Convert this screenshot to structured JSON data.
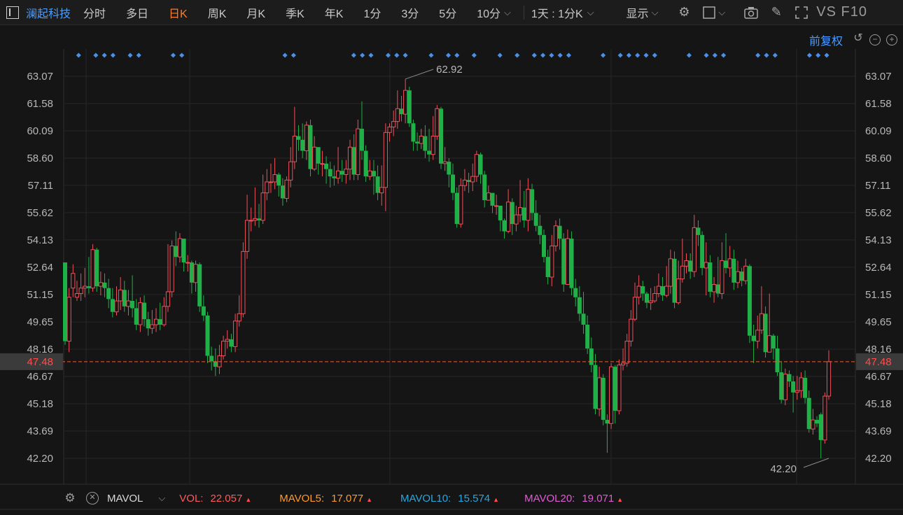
{
  "toolbar": {
    "stock_name": "澜起科技",
    "tabs": [
      "分时",
      "多日",
      "日K",
      "周K",
      "月K",
      "季K",
      "年K",
      "1分",
      "3分",
      "5分",
      "10分"
    ],
    "active_tab": "日K",
    "period": "1天 : 1分K",
    "display": "显示",
    "f10": "VS F10"
  },
  "subbar": {
    "adjust": "前复权"
  },
  "colors": {
    "up": "#f0505a",
    "down": "#1fb148",
    "bg": "#151515",
    "accent": "#4a9cff",
    "current": "#e8613a"
  },
  "chart_data": {
    "type": "candlestick",
    "y_ticks": [
      "63.07",
      "61.58",
      "60.09",
      "58.60",
      "57.11",
      "55.62",
      "54.13",
      "52.64",
      "51.15",
      "49.65",
      "48.16",
      "46.67",
      "45.18",
      "43.69",
      "42.20"
    ],
    "ylim": [
      42.2,
      63.07
    ],
    "current_price": "47.48",
    "max_label": "62.92",
    "min_label": "42.20",
    "candles": [
      [
        52.9,
        48.6,
        52.9,
        48.4
      ],
      [
        48.6,
        51.0,
        51.5,
        48.0
      ],
      [
        51.5,
        52.3,
        52.8,
        51.0
      ],
      [
        51.0,
        51.2,
        51.9,
        50.8
      ],
      [
        51.2,
        51.5,
        52.3,
        50.8
      ],
      [
        51.5,
        51.6,
        52.6,
        51.0
      ],
      [
        51.6,
        51.5,
        53.2,
        51.2
      ],
      [
        51.5,
        53.6,
        53.9,
        51.3
      ],
      [
        53.6,
        51.6,
        53.7,
        51.3
      ],
      [
        51.6,
        51.8,
        52.4,
        51.1
      ],
      [
        51.8,
        51.5,
        52.3,
        51.0
      ],
      [
        51.5,
        50.9,
        52.0,
        50.4
      ],
      [
        50.9,
        50.2,
        51.5,
        49.9
      ],
      [
        50.2,
        50.8,
        51.6,
        50.0
      ],
      [
        50.8,
        51.4,
        52.1,
        50.3
      ],
      [
        51.4,
        50.5,
        51.9,
        50.2
      ],
      [
        50.5,
        50.8,
        51.4,
        50.0
      ],
      [
        50.8,
        50.4,
        52.2,
        49.9
      ],
      [
        50.4,
        49.5,
        50.9,
        49.2
      ],
      [
        49.5,
        50.7,
        51.0,
        49.1
      ],
      [
        50.7,
        49.8,
        51.1,
        49.4
      ],
      [
        49.8,
        49.3,
        50.2,
        48.9
      ],
      [
        49.3,
        49.5,
        50.3,
        49.0
      ],
      [
        49.5,
        49.8,
        50.4,
        49.1
      ],
      [
        49.8,
        49.5,
        50.7,
        49.2
      ],
      [
        49.5,
        50.5,
        51.0,
        49.4
      ],
      [
        50.5,
        51.3,
        53.9,
        50.2
      ],
      [
        51.3,
        53.8,
        54.1,
        51.0
      ],
      [
        53.8,
        53.2,
        54.6,
        52.7
      ],
      [
        53.2,
        54.2,
        54.5,
        52.9
      ],
      [
        54.2,
        52.9,
        53.6,
        52.4
      ],
      [
        52.9,
        52.9,
        53.3,
        52.4
      ],
      [
        52.9,
        51.8,
        53.0,
        51.2
      ],
      [
        51.8,
        52.8,
        53.0,
        51.3
      ],
      [
        52.8,
        50.5,
        52.9,
        50.2
      ],
      [
        50.5,
        50.0,
        51.1,
        49.7
      ],
      [
        50.0,
        47.8,
        50.2,
        47.4
      ],
      [
        47.8,
        47.5,
        48.3,
        47.0
      ],
      [
        47.5,
        47.2,
        48.2,
        46.7
      ],
      [
        47.2,
        47.8,
        48.4,
        46.8
      ],
      [
        47.8,
        48.6,
        48.9,
        47.6
      ],
      [
        48.6,
        48.7,
        49.2,
        48.2
      ],
      [
        48.7,
        48.3,
        49.0,
        48.0
      ],
      [
        48.3,
        49.7,
        50.1,
        48.0
      ],
      [
        49.7,
        50.1,
        51.1,
        49.4
      ],
      [
        50.1,
        53.5,
        54.0,
        49.9
      ],
      [
        53.5,
        55.2,
        56.6,
        53.1
      ],
      [
        55.2,
        55.2,
        55.9,
        54.6
      ],
      [
        55.2,
        55.3,
        57.0,
        54.9
      ],
      [
        55.3,
        55.2,
        56.1,
        54.8
      ],
      [
        55.2,
        56.7,
        57.7,
        55.0
      ],
      [
        56.7,
        57.3,
        58.0,
        56.3
      ],
      [
        57.3,
        57.3,
        58.3,
        56.7
      ],
      [
        57.3,
        57.7,
        58.6,
        56.9
      ],
      [
        57.7,
        57.1,
        57.8,
        56.5
      ],
      [
        57.1,
        56.4,
        57.5,
        56.0
      ],
      [
        56.4,
        57.4,
        57.6,
        56.2
      ],
      [
        57.4,
        58.4,
        59.2,
        57.0
      ],
      [
        58.4,
        59.8,
        61.4,
        58.0
      ],
      [
        59.8,
        59.6,
        60.4,
        59.0
      ],
      [
        59.6,
        59.0,
        60.5,
        58.6
      ],
      [
        59.0,
        60.4,
        60.6,
        58.5
      ],
      [
        60.4,
        58.0,
        60.7,
        57.6
      ],
      [
        58.0,
        59.2,
        59.8,
        57.9
      ],
      [
        59.2,
        58.3,
        58.6,
        57.7
      ],
      [
        58.3,
        58.3,
        59.0,
        57.6
      ],
      [
        58.3,
        58.0,
        58.7,
        57.2
      ],
      [
        58.0,
        57.6,
        58.4,
        57.0
      ],
      [
        57.6,
        57.5,
        58.2,
        57.1
      ],
      [
        57.5,
        57.9,
        59.2,
        57.2
      ],
      [
        57.9,
        57.7,
        58.5,
        57.3
      ],
      [
        57.7,
        58.0,
        58.5,
        57.2
      ],
      [
        58.0,
        59.2,
        59.6,
        57.4
      ],
      [
        59.2,
        57.7,
        59.9,
        57.4
      ],
      [
        57.7,
        60.2,
        60.7,
        57.4
      ],
      [
        60.2,
        59.0,
        61.7,
        58.5
      ],
      [
        59.0,
        57.6,
        59.3,
        57.3
      ],
      [
        57.6,
        57.9,
        58.5,
        57.4
      ],
      [
        57.9,
        57.6,
        58.5,
        56.6
      ],
      [
        57.6,
        56.7,
        58.2,
        56.3
      ],
      [
        56.7,
        57.0,
        58.2,
        56.0
      ],
      [
        57.0,
        60.0,
        60.5,
        55.7
      ],
      [
        60.0,
        60.3,
        60.5,
        59.5
      ],
      [
        60.3,
        60.6,
        61.2,
        59.8
      ],
      [
        60.6,
        61.3,
        62.3,
        60.2
      ],
      [
        61.3,
        61.0,
        62.0,
        60.6
      ],
      [
        61.0,
        62.3,
        62.92,
        60.5
      ],
      [
        62.3,
        60.5,
        62.5,
        60.3
      ],
      [
        60.5,
        59.5,
        60.7,
        59.0
      ],
      [
        59.5,
        59.4,
        60.0,
        59.0
      ],
      [
        59.4,
        59.8,
        60.2,
        59.1
      ],
      [
        59.8,
        59.0,
        60.4,
        58.6
      ],
      [
        59.0,
        58.8,
        60.2,
        58.4
      ],
      [
        58.8,
        59.8,
        60.9,
        58.5
      ],
      [
        59.8,
        61.3,
        61.5,
        59.6
      ],
      [
        61.3,
        58.3,
        61.4,
        58.0
      ],
      [
        58.3,
        58.4,
        59.2,
        57.9
      ],
      [
        58.4,
        57.7,
        58.6,
        57.0
      ],
      [
        57.7,
        56.7,
        58.3,
        56.3
      ],
      [
        56.7,
        55.0,
        57.0,
        54.8
      ],
      [
        55.0,
        57.1,
        57.5,
        54.8
      ],
      [
        57.1,
        57.4,
        58.0,
        56.8
      ],
      [
        57.4,
        57.3,
        57.8,
        56.7
      ],
      [
        57.3,
        57.6,
        58.3,
        56.8
      ],
      [
        57.6,
        58.8,
        59.0,
        57.3
      ],
      [
        58.8,
        57.7,
        58.9,
        57.2
      ],
      [
        57.7,
        56.3,
        57.9,
        55.9
      ],
      [
        56.3,
        56.7,
        57.1,
        56.3
      ],
      [
        56.7,
        56.0,
        56.6,
        55.6
      ],
      [
        56.0,
        56.0,
        56.6,
        55.5
      ],
      [
        56.0,
        55.2,
        55.8,
        54.6
      ],
      [
        55.2,
        54.6,
        55.3,
        54.2
      ],
      [
        54.6,
        56.2,
        56.9,
        54.5
      ],
      [
        56.2,
        55.0,
        56.4,
        54.4
      ],
      [
        55.0,
        55.5,
        56.0,
        54.6
      ],
      [
        55.5,
        55.9,
        57.4,
        55.1
      ],
      [
        55.9,
        55.2,
        56.8,
        54.8
      ],
      [
        55.2,
        56.9,
        57.5,
        54.6
      ],
      [
        56.9,
        55.6,
        57.2,
        55.2
      ],
      [
        55.6,
        54.9,
        56.3,
        54.6
      ],
      [
        54.9,
        54.4,
        55.5,
        53.9
      ],
      [
        54.4,
        53.2,
        54.7,
        52.9
      ],
      [
        53.2,
        52.1,
        53.6,
        51.7
      ],
      [
        52.1,
        53.8,
        54.4,
        51.6
      ],
      [
        53.8,
        54.9,
        55.2,
        53.5
      ],
      [
        54.9,
        54.2,
        55.3,
        53.6
      ],
      [
        54.2,
        51.7,
        54.5,
        51.3
      ],
      [
        51.7,
        54.2,
        54.7,
        53.9
      ],
      [
        54.2,
        51.5,
        54.6,
        51.1
      ],
      [
        51.5,
        51.0,
        52.0,
        50.5
      ],
      [
        51.0,
        50.1,
        51.6,
        49.7
      ],
      [
        50.1,
        49.5,
        51.3,
        49.0
      ],
      [
        49.5,
        48.2,
        50.0,
        47.9
      ],
      [
        48.2,
        47.3,
        48.8,
        46.9
      ],
      [
        47.3,
        44.9,
        47.9,
        44.6
      ],
      [
        44.9,
        46.6,
        47.2,
        44.5
      ],
      [
        46.6,
        44.3,
        46.8,
        44.0
      ],
      [
        44.3,
        44.1,
        44.6,
        42.5
      ],
      [
        44.1,
        47.2,
        47.4,
        43.8
      ],
      [
        47.2,
        44.8,
        47.3,
        44.1
      ],
      [
        44.8,
        47.3,
        47.6,
        44.6
      ],
      [
        47.3,
        47.4,
        48.2,
        47.0
      ],
      [
        47.4,
        48.6,
        49.0,
        47.2
      ],
      [
        48.6,
        49.8,
        50.3,
        48.3
      ],
      [
        49.8,
        51.0,
        51.8,
        49.7
      ],
      [
        51.0,
        51.6,
        52.2,
        50.6
      ],
      [
        51.6,
        51.2,
        51.9,
        50.8
      ],
      [
        51.2,
        50.7,
        51.3,
        50.4
      ],
      [
        50.7,
        50.8,
        51.5,
        50.3
      ],
      [
        50.8,
        51.2,
        51.6,
        50.7
      ],
      [
        51.2,
        51.6,
        52.3,
        51.0
      ],
      [
        51.6,
        51.1,
        52.1,
        50.8
      ],
      [
        51.1,
        51.6,
        52.7,
        51.0
      ],
      [
        51.6,
        53.1,
        53.6,
        51.2
      ],
      [
        53.1,
        50.7,
        53.5,
        50.4
      ],
      [
        50.7,
        52.0,
        53.0,
        50.6
      ],
      [
        52.0,
        52.7,
        54.2,
        51.8
      ],
      [
        52.7,
        53.0,
        53.4,
        52.3
      ],
      [
        53.0,
        52.4,
        53.4,
        52.0
      ],
      [
        52.4,
        54.8,
        55.5,
        52.1
      ],
      [
        54.8,
        54.4,
        55.2,
        53.8
      ],
      [
        54.4,
        52.6,
        54.6,
        52.2
      ],
      [
        52.6,
        52.9,
        54.0,
        51.1
      ],
      [
        52.9,
        51.3,
        53.3,
        51.0
      ],
      [
        51.3,
        51.7,
        52.1,
        50.7
      ],
      [
        51.7,
        51.2,
        53.2,
        51.0
      ],
      [
        51.2,
        53.0,
        54.0,
        50.9
      ],
      [
        53.0,
        52.6,
        54.5,
        52.3
      ],
      [
        52.6,
        53.1,
        53.8,
        52.1
      ],
      [
        53.1,
        51.8,
        53.6,
        51.4
      ],
      [
        51.8,
        52.4,
        53.0,
        51.5
      ],
      [
        52.4,
        51.9,
        52.6,
        51.6
      ],
      [
        51.9,
        52.7,
        53.1,
        51.7
      ],
      [
        52.7,
        48.9,
        52.8,
        48.5
      ],
      [
        48.9,
        48.6,
        49.5,
        47.4
      ],
      [
        48.6,
        49.2,
        50.0,
        48.2
      ],
      [
        49.2,
        50.1,
        51.6,
        49.0
      ],
      [
        50.1,
        48.0,
        50.5,
        47.7
      ],
      [
        48.0,
        48.9,
        51.2,
        48.1
      ],
      [
        48.9,
        48.2,
        49.0,
        47.6
      ],
      [
        48.2,
        46.9,
        48.9,
        46.7
      ],
      [
        46.9,
        45.4,
        47.5,
        45.2
      ],
      [
        45.4,
        46.8,
        47.1,
        45.1
      ],
      [
        46.8,
        46.4,
        47.0,
        46.1
      ],
      [
        46.4,
        45.8,
        46.7,
        44.7
      ],
      [
        45.8,
        45.9,
        46.7,
        45.4
      ],
      [
        45.9,
        46.6,
        46.9,
        45.5
      ],
      [
        46.6,
        45.5,
        47.0,
        45.2
      ],
      [
        45.5,
        43.8,
        45.9,
        43.6
      ],
      [
        43.8,
        44.3,
        44.9,
        43.5
      ],
      [
        44.3,
        44.1,
        44.5,
        43.9
      ],
      [
        44.6,
        43.2,
        44.7,
        42.2
      ],
      [
        43.2,
        45.6,
        45.8,
        43.0
      ],
      [
        45.6,
        47.48,
        48.1,
        45.4
      ]
    ],
    "markers": [
      1,
      3,
      4,
      5,
      7,
      8,
      12,
      13,
      25,
      26,
      33,
      34,
      35,
      37,
      38,
      39,
      42,
      44,
      45,
      47,
      50,
      52,
      54,
      55,
      56,
      57,
      58,
      62,
      64,
      65,
      66,
      67,
      68,
      72,
      74,
      75,
      76,
      80,
      81,
      82,
      86,
      87,
      88
    ]
  },
  "indicators": {
    "name": "MAVOL",
    "items": [
      {
        "label": "VOL:",
        "value": "22.057",
        "color": "#ff5a5a"
      },
      {
        "label": "MAVOL5:",
        "value": "17.077",
        "color": "#ff9a2a"
      },
      {
        "label": "MAVOL10:",
        "value": "15.574",
        "color": "#27a7e0"
      },
      {
        "label": "MAVOL20:",
        "value": "19.071",
        "color": "#e25ad6"
      }
    ]
  }
}
